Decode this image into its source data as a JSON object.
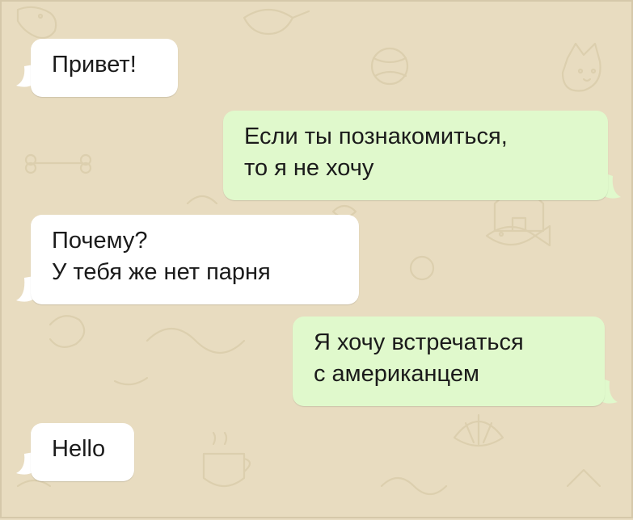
{
  "colors": {
    "background": "#e8dcc0",
    "incoming_bubble": "#ffffff",
    "outgoing_bubble": "#e0f9cc",
    "doodle": "#dccfae"
  },
  "messages": [
    {
      "direction": "incoming",
      "lines": [
        "Привет!"
      ]
    },
    {
      "direction": "outgoing",
      "lines": [
        "Если ты познакомиться,",
        "то я не хочу"
      ]
    },
    {
      "direction": "incoming",
      "lines": [
        "Почему?",
        "У тебя же нет парня"
      ]
    },
    {
      "direction": "outgoing",
      "lines": [
        "Я хочу встречаться",
        "с американцем"
      ]
    },
    {
      "direction": "incoming",
      "lines": [
        "Hello"
      ]
    }
  ],
  "background_doodles": [
    "dog-icon",
    "cat-icon",
    "bird-icon",
    "fish-icon",
    "house-icon",
    "bone-icon",
    "ball-icon",
    "cup-icon",
    "shell-icon"
  ]
}
